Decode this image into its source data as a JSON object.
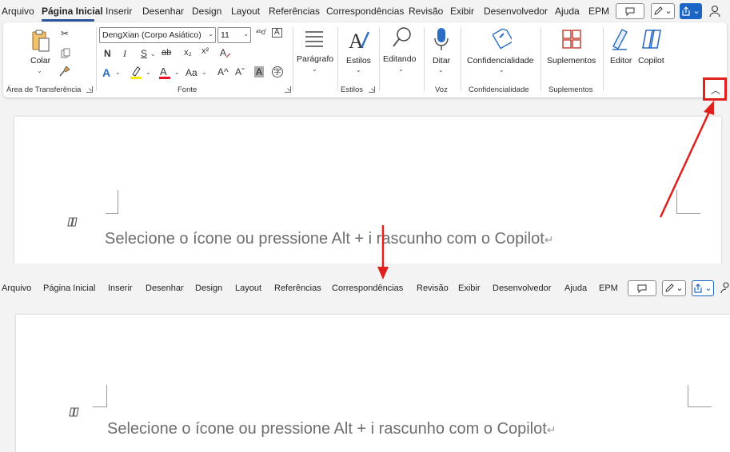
{
  "top": {
    "tabs": [
      "Arquivo",
      "Página Inicial",
      "Inserir",
      "Desenhar",
      "Design",
      "Layout",
      "Referências",
      "Correspondências",
      "Revisão",
      "Exibir",
      "Desenvolvedor",
      "Ajuda",
      "EPM"
    ],
    "active_tab": "Página Inicial",
    "clipboard": {
      "paste_label": "Colar",
      "group_label": "Área de Transferência"
    },
    "font": {
      "font_name": "DengXian (Corpo Asiático)",
      "font_size": "11",
      "bold": "N",
      "italic": "I",
      "underline": "S",
      "strike": "ab",
      "subscript": "x₂",
      "superscript": "x²",
      "change_case": "Aa",
      "grow": "A^",
      "shrink": "Aˇ",
      "group_label": "Fonte"
    },
    "paragraph": {
      "label": "Parágrafo"
    },
    "styles": {
      "label": "Estilos",
      "group_label": "Estilos"
    },
    "editing": {
      "label": "Editando"
    },
    "voice": {
      "dictate_label": "Ditar",
      "group_label": "Voz"
    },
    "sensitivity": {
      "label": "Confidencialidade",
      "group_label": "Confidencialidade"
    },
    "addins": {
      "label": "Suplementos",
      "group_label": "Suplementos"
    },
    "editor": {
      "label": "Editor"
    },
    "copilot": {
      "label": "Copilot"
    }
  },
  "document": {
    "placeholder": "Selecione o ícone ou pressione Alt + i rascunho com o Copilot",
    "pilcrow": "↵"
  },
  "bottom": {
    "tabs": [
      "Arquivo",
      "Página Inicial",
      "Inserir",
      "Desenhar",
      "Design",
      "Layout",
      "Referências",
      "Correspondências",
      "Revisão",
      "Exibir",
      "Desenvolvedor",
      "Ajuda",
      "EPM"
    ]
  },
  "colors": {
    "accent": "#2b579a",
    "annotation_red": "#e0201c",
    "ribbon_bg": "#f3f3f3",
    "highlight_yellow": "#ffe800",
    "font_color_red": "#e81123"
  }
}
